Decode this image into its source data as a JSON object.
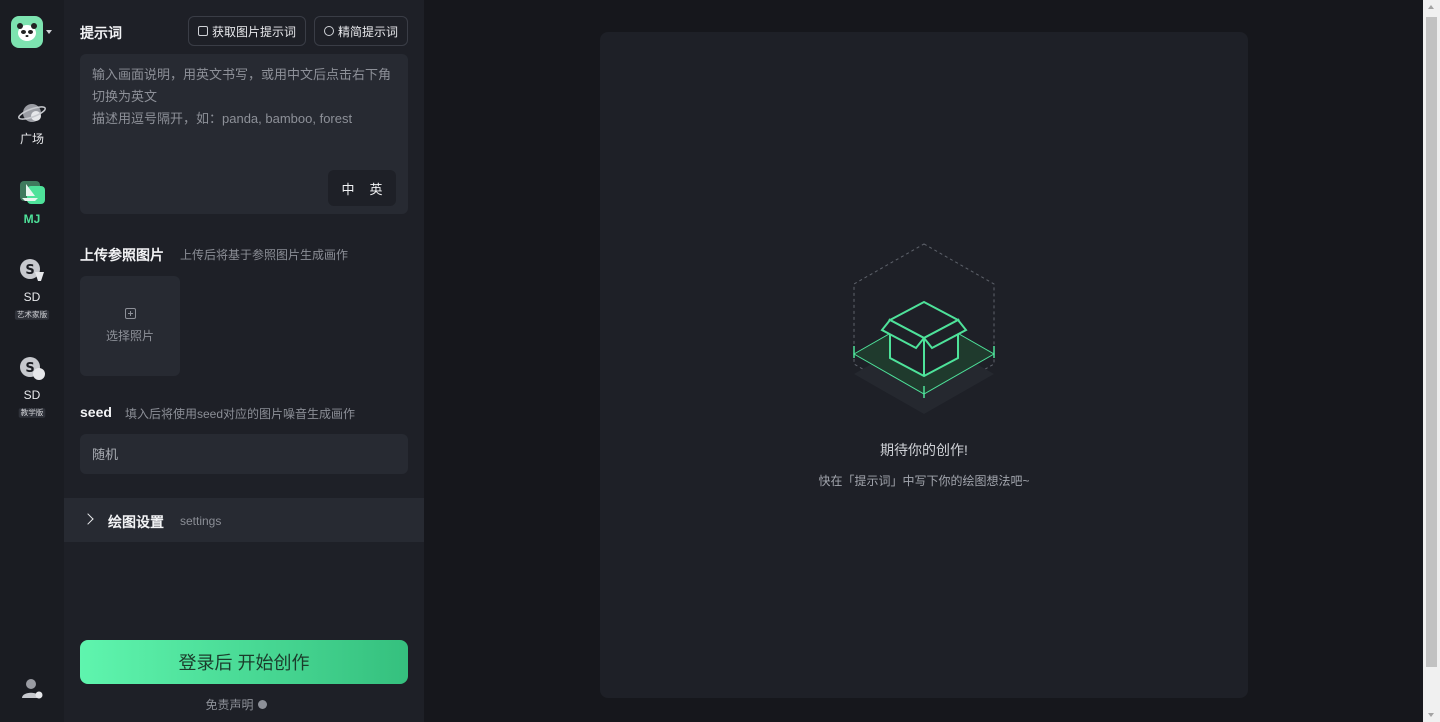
{
  "nav": {
    "items": [
      {
        "label": "广场",
        "icon": "planet-icon",
        "tag": "",
        "active": false
      },
      {
        "label": "MJ",
        "icon": "mj-sail-icon",
        "tag": "",
        "active": true
      },
      {
        "label": "SD",
        "icon": "sd-artist-icon",
        "tag": "艺术家版",
        "active": false
      },
      {
        "label": "SD",
        "icon": "sd-teaching-icon",
        "tag": "教学版",
        "active": false
      }
    ]
  },
  "prompt": {
    "title": "提示词",
    "get_image_prompt": "获取图片提示词",
    "simplify_prompt": "精简提示词",
    "placeholder": "输入画面说明，用英文书写，或用中文后点击右下角切换为英文\n描述用逗号隔开，如：panda, bamboo, forest",
    "lang_zh": "中",
    "lang_en": "英"
  },
  "upload": {
    "title": "上传参照图片",
    "subtitle": "上传后将基于参照图片生成画作",
    "select_label": "选择照片"
  },
  "seed": {
    "title": "seed",
    "subtitle": "填入后将使用seed对应的图片噪音生成画作",
    "placeholder": "随机"
  },
  "settings": {
    "title": "绘图设置",
    "subtitle": "settings"
  },
  "cta": {
    "label": "登录后 开始创作"
  },
  "disclaimer": "免责声明",
  "empty_state": {
    "title": "期待你的创作!",
    "subtitle": "快在「提示词」中写下你的绘图想法吧~"
  },
  "colors": {
    "accent": "#4ee29a",
    "panel": "#1e2027",
    "background": "#16171c"
  }
}
